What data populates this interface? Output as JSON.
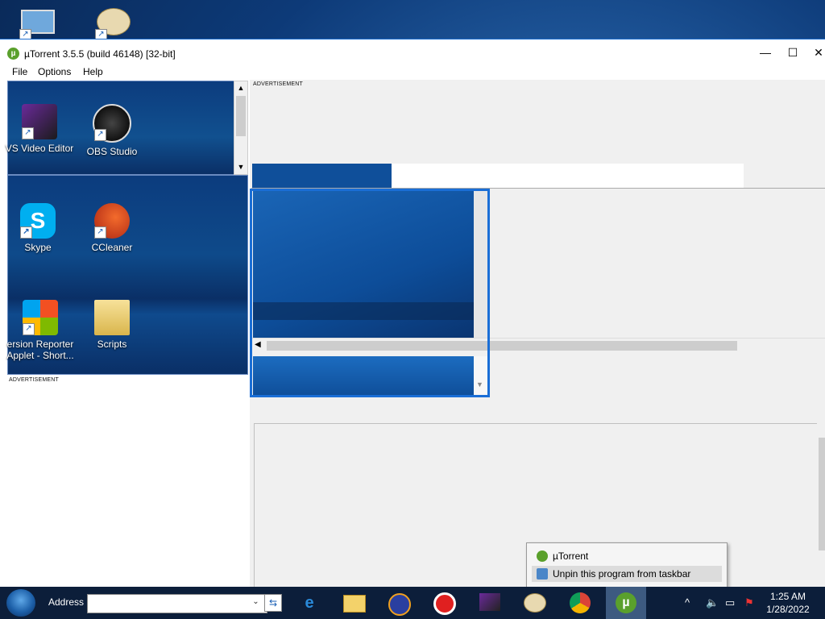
{
  "desktop": {
    "icons": [
      {
        "label": "VS Video Editor"
      },
      {
        "label": "OBS Studio"
      },
      {
        "label": "Skype"
      },
      {
        "label": "CCleaner"
      },
      {
        "label": "ersion Reporter Applet - Short..."
      },
      {
        "label": "Scripts"
      }
    ]
  },
  "window": {
    "title": "µTorrent 3.5.5  (build 46148) [32-bit]",
    "menu": [
      "File",
      "Options",
      "Help"
    ],
    "ad_label_top": "ADVERTISEMENT",
    "ad_label_left": "ADVERTISEMENT",
    "controls": {
      "minimize": "—",
      "maximize": "☐",
      "close": "✕"
    }
  },
  "jumplist": {
    "title_item": "µTorrent",
    "unpin_item": "Unpin this program from taskbar"
  },
  "taskbar": {
    "address_label": "Address",
    "address_value": "",
    "pinned": [
      "internet-explorer-icon",
      "file-explorer-icon",
      "app-icon",
      "record-icon",
      "video-editor-icon",
      "paint-icon",
      "chrome-icon",
      "utorrent-icon"
    ]
  },
  "tray": {
    "time": "1:25 AM",
    "date": "1/28/2022"
  },
  "colors": {
    "accent": "#1a6ed6",
    "utorrent_green": "#5aa02c",
    "taskbar": "#0c1e3a"
  }
}
